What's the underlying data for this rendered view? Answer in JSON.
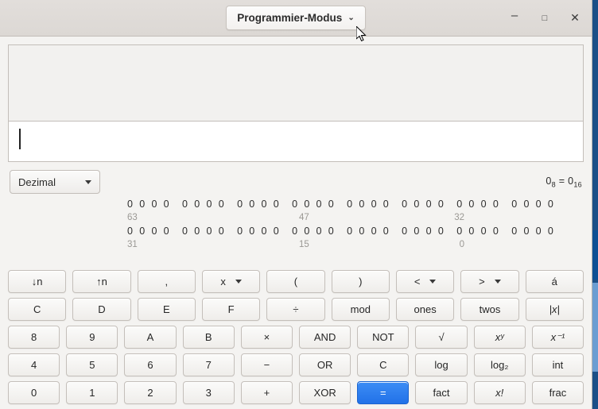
{
  "window": {
    "mode_title": "Programmier-Modus",
    "mode_chevron": "⌄",
    "minimize_label": "–",
    "maximize_label": "□",
    "close_label": "✕"
  },
  "display": {
    "history_text": "",
    "entry_text": ""
  },
  "base": {
    "selected": "Dezimal",
    "conversion_prefix": "0",
    "conversion_sub_from": "8",
    "conversion_equals": "=",
    "conversion_value": "0",
    "conversion_sub_to": "16"
  },
  "bits": {
    "nibble": "0000",
    "groups_per_row": 8,
    "row_high": {
      "label_left": "63",
      "label_mid": "47",
      "label_right": "32"
    },
    "row_low": {
      "label_left": "31",
      "label_mid": "15",
      "label_right": "0"
    }
  },
  "keypad": {
    "rows": [
      [
        {
          "label": "↓n",
          "name": "key-shift-right"
        },
        {
          "label": "↑n",
          "name": "key-shift-left"
        },
        {
          "label": ",",
          "name": "key-comma"
        },
        {
          "label": "x",
          "name": "key-variable-x",
          "chevron": true
        },
        {
          "label": "(",
          "name": "key-paren-open"
        },
        {
          "label": ")",
          "name": "key-paren-close"
        },
        {
          "label": "<",
          "name": "key-less-than",
          "chevron": true
        },
        {
          "label": ">",
          "name": "key-greater-than",
          "chevron": true
        },
        {
          "label": "á",
          "name": "key-a-acute"
        }
      ],
      [
        {
          "label": "C",
          "name": "key-hex-c"
        },
        {
          "label": "D",
          "name": "key-hex-d"
        },
        {
          "label": "E",
          "name": "key-hex-e"
        },
        {
          "label": "F",
          "name": "key-hex-f"
        },
        {
          "label": "÷",
          "name": "key-divide"
        },
        {
          "label": "mod",
          "name": "key-mod"
        },
        {
          "label": "ones",
          "name": "key-ones-complement"
        },
        {
          "label": "twos",
          "name": "key-twos-complement"
        },
        {
          "label": "|x|",
          "name": "key-absolute",
          "italic": true
        }
      ],
      [
        {
          "label": "8",
          "name": "key-8"
        },
        {
          "label": "9",
          "name": "key-9"
        },
        {
          "label": "A",
          "name": "key-hex-a"
        },
        {
          "label": "B",
          "name": "key-hex-b"
        },
        {
          "label": "×",
          "name": "key-multiply"
        },
        {
          "label": "AND",
          "name": "key-and"
        },
        {
          "label": "NOT",
          "name": "key-not"
        },
        {
          "label": "√",
          "name": "key-square-root"
        },
        {
          "label": "xʸ",
          "name": "key-power",
          "italic": true
        },
        {
          "label": "x⁻¹",
          "name": "key-reciprocal",
          "italic": true
        }
      ],
      [
        {
          "label": "4",
          "name": "key-4"
        },
        {
          "label": "5",
          "name": "key-5"
        },
        {
          "label": "6",
          "name": "key-6"
        },
        {
          "label": "7",
          "name": "key-7"
        },
        {
          "label": "−",
          "name": "key-subtract"
        },
        {
          "label": "OR",
          "name": "key-or"
        },
        {
          "label": "C",
          "name": "key-clear"
        },
        {
          "label": "log",
          "name": "key-log"
        },
        {
          "label": "log₂",
          "name": "key-log2"
        },
        {
          "label": "int",
          "name": "key-integer-part"
        }
      ],
      [
        {
          "label": "0",
          "name": "key-0"
        },
        {
          "label": "1",
          "name": "key-1"
        },
        {
          "label": "2",
          "name": "key-2"
        },
        {
          "label": "3",
          "name": "key-3"
        },
        {
          "label": "+",
          "name": "key-add"
        },
        {
          "label": "XOR",
          "name": "key-xor"
        },
        {
          "label": "=",
          "name": "key-equals",
          "accent": true
        },
        {
          "label": "fact",
          "name": "key-factorize"
        },
        {
          "label": "x!",
          "name": "key-factorial",
          "italic": true
        },
        {
          "label": "frac",
          "name": "key-fractional-part"
        }
      ]
    ]
  },
  "colors": {
    "accent": "#2272e8",
    "window_bg": "#f4f3f1",
    "titlebar_bg": "#ddd9d5",
    "desktop_blue": "#0d4f94",
    "desktop_blue_light": "#6b9dd2"
  }
}
